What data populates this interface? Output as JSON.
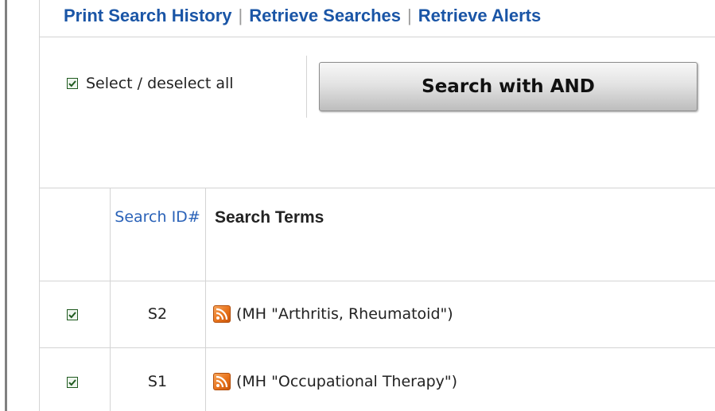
{
  "toolbar": {
    "print_history": "Print Search History",
    "retrieve_searches": "Retrieve Searches",
    "retrieve_alerts": "Retrieve Alerts",
    "separator": "|"
  },
  "controls": {
    "select_all_label": "Select / deselect all",
    "select_all_checked": true,
    "search_button_label": "Search with AND"
  },
  "table": {
    "header_search_id": "Search ID#",
    "header_search_terms": "Search Terms",
    "rows": [
      {
        "checked": true,
        "id": "S2",
        "terms": "(MH \"Arthritis, Rheumatoid\")"
      },
      {
        "checked": true,
        "id": "S1",
        "terms": "(MH \"Occupational Therapy\")"
      }
    ]
  },
  "colors": {
    "link": "#1a55a6",
    "header_link": "#2a62b8",
    "rss_orange": "#e8731c",
    "checkbox_green": "#1f5a1f"
  },
  "icons": {
    "checkbox": "checkmark-icon",
    "rss": "rss-feed-icon"
  }
}
